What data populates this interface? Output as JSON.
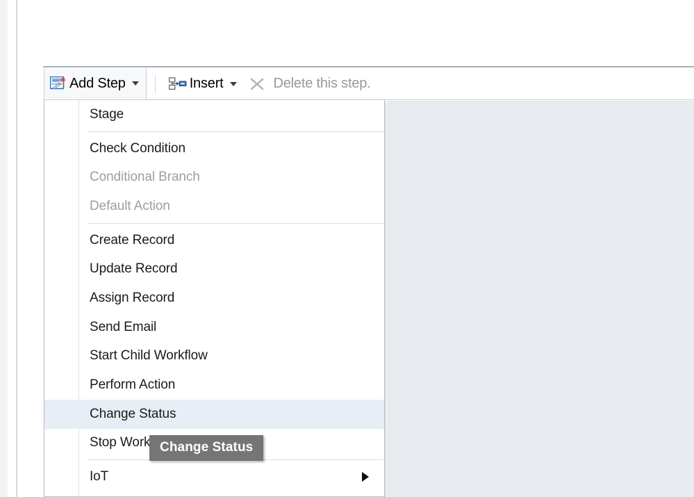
{
  "colors": {
    "accent_blue": "#2e6da4",
    "menu_highlight": "#e8eef5",
    "workspace_panel": "#e7eaee",
    "tooltip_bg": "#757575",
    "disabled_text": "#9b9ea3",
    "toolbar_border": "#a9afb9"
  },
  "toolbar": {
    "add_step": {
      "label": "Add Step",
      "icon": "add-step-icon",
      "caret": "chevron-down-icon",
      "state": "open"
    },
    "insert": {
      "label": "Insert",
      "icon": "insert-step-icon",
      "caret": "chevron-down-icon"
    },
    "delete": {
      "label": "Delete this step.",
      "icon": "close-x-icon",
      "disabled": true
    }
  },
  "menu": {
    "groups": [
      {
        "items": [
          {
            "label": "Stage",
            "disabled": false,
            "highlighted": false,
            "has_submenu": false
          }
        ]
      },
      {
        "items": [
          {
            "label": "Check Condition",
            "disabled": false,
            "highlighted": false,
            "has_submenu": false
          },
          {
            "label": "Conditional Branch",
            "disabled": true,
            "highlighted": false,
            "has_submenu": false
          },
          {
            "label": "Default Action",
            "disabled": true,
            "highlighted": false,
            "has_submenu": false
          }
        ]
      },
      {
        "items": [
          {
            "label": "Create Record",
            "disabled": false,
            "highlighted": false,
            "has_submenu": false
          },
          {
            "label": "Update Record",
            "disabled": false,
            "highlighted": false,
            "has_submenu": false
          },
          {
            "label": "Assign Record",
            "disabled": false,
            "highlighted": false,
            "has_submenu": false
          },
          {
            "label": "Send Email",
            "disabled": false,
            "highlighted": false,
            "has_submenu": false
          },
          {
            "label": "Start Child Workflow",
            "disabled": false,
            "highlighted": false,
            "has_submenu": false
          },
          {
            "label": "Perform Action",
            "disabled": false,
            "highlighted": false,
            "has_submenu": false
          },
          {
            "label": "Change Status",
            "disabled": false,
            "highlighted": true,
            "has_submenu": false
          },
          {
            "label": "Stop Workflow",
            "disabled": false,
            "highlighted": false,
            "has_submenu": false
          }
        ]
      },
      {
        "items": [
          {
            "label": "IoT",
            "disabled": false,
            "highlighted": false,
            "has_submenu": true
          }
        ]
      }
    ]
  },
  "tooltip": {
    "text": "Change Status"
  }
}
